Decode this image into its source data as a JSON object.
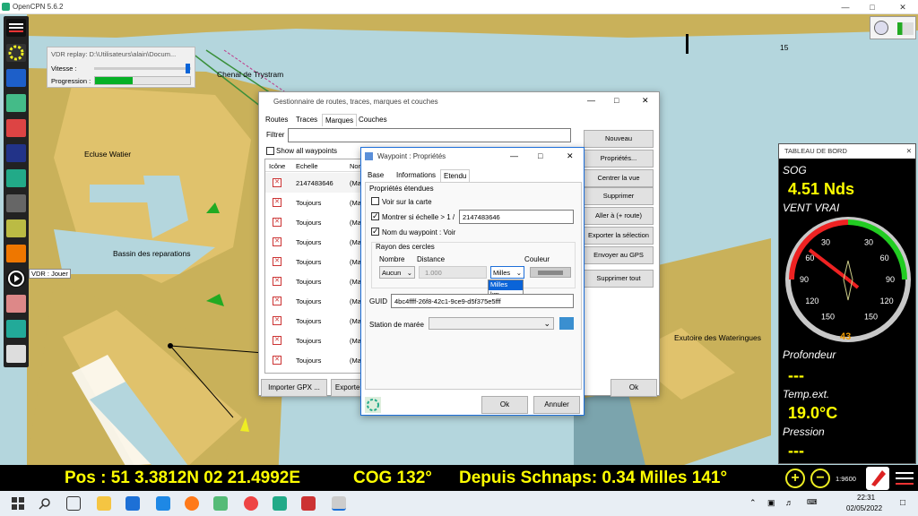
{
  "window": {
    "title": "OpenCPN 5.6.2"
  },
  "map": {
    "labels": [
      "Chenal de Trystram",
      "Ecluse Watier",
      "Bassin des reparations",
      "Exutoire des Wateringues"
    ],
    "depth_label": "15",
    "vdr_tooltip": "VDR : Jouer"
  },
  "vdr": {
    "title": "VDR replay: D:\\Utilisateurs\\alain\\Docum...",
    "speed_label": "Vitesse :",
    "progress_label": "Progression :",
    "progress": 0.4
  },
  "route_manager": {
    "title": "Gestionnaire de routes, traces, marques et couches",
    "tabs": [
      "Routes",
      "Traces",
      "Marques",
      "Couches"
    ],
    "active_tab": "Marques",
    "filter_label": "Filtrer",
    "show_all": "Show all waypoints",
    "columns": [
      "Icône",
      "Echelle",
      "Nor"
    ],
    "rows": [
      {
        "scale": "2147483646",
        "name": "(Ma"
      },
      {
        "scale": "Toujours",
        "name": "(Ma"
      },
      {
        "scale": "Toujours",
        "name": "(Ma"
      },
      {
        "scale": "Toujours",
        "name": "(Ma"
      },
      {
        "scale": "Toujours",
        "name": "(Ma"
      },
      {
        "scale": "Toujours",
        "name": "(Ma"
      },
      {
        "scale": "Toujours",
        "name": "(Ma"
      },
      {
        "scale": "Toujours",
        "name": "(Ma"
      },
      {
        "scale": "Toujours",
        "name": "(Ma"
      },
      {
        "scale": "Toujours",
        "name": "(Ma"
      }
    ],
    "buttons": [
      "Nouveau",
      "Propriétés...",
      "Centrer la vue",
      "Supprimer",
      "Aller à (+ route)",
      "Exporter la sélection",
      "Envoyer au GPS",
      "Supprimer tout"
    ],
    "import_btn": "Importer GPX ...",
    "export_btn": "Exporter",
    "ok": "Ok"
  },
  "waypoint": {
    "title": "Waypoint : Propriétés",
    "tabs": [
      "Base",
      "Informations",
      "Etendu"
    ],
    "active_tab": "Etendu",
    "section_title": "Propriétés étendues",
    "show_on_chart": "Voir sur la carte",
    "show_if_scale": "Montrer si échelle > 1 /",
    "scale_value": "2147483646",
    "show_name": "Nom du waypoint : Voir",
    "rings_title": "Rayon des cercles",
    "col_number": "Nombre",
    "col_distance": "Distance",
    "col_color": "Couleur",
    "number_value": "Aucun",
    "distance_value": "1.000",
    "unit_value": "Milles",
    "unit_options": [
      "Milles",
      "km"
    ],
    "guid_label": "GUID",
    "guid_value": "4bc4ffff-26f8-42c1-9ce9-d5f375e5fff",
    "tide_label": "Station de marée",
    "ok": "Ok",
    "cancel": "Annuler"
  },
  "dashboard": {
    "title": "TABLEAU DE BORD",
    "sog_label": "SOG",
    "sog_value": "4.51 Nds",
    "wind_label": "VENT VRAI",
    "wind_center": "43",
    "dial_labels": [
      "30",
      "60",
      "90",
      "120",
      "150",
      "150",
      "120",
      "90",
      "60",
      "30"
    ],
    "depth_label": "Profondeur",
    "depth_value": "---",
    "temp_label": "Temp.ext.",
    "temp_value": "19.0°C",
    "pressure_label": "Pression",
    "pressure_value": "---"
  },
  "status": {
    "pos": "Pos : 51 3.3812N  02 21.4992E",
    "cog": "COG 132°",
    "since": "Depuis Schnaps: 0.34 Milles 141°",
    "scale": "1:9600"
  },
  "taskbar": {
    "time": "22:31",
    "date": "02/05/2022"
  },
  "colors": {
    "map_water": "#b4d6dd",
    "land": "#c9b15a",
    "dock": "#e0c26c",
    "dashboard_value": "#ffff00"
  }
}
